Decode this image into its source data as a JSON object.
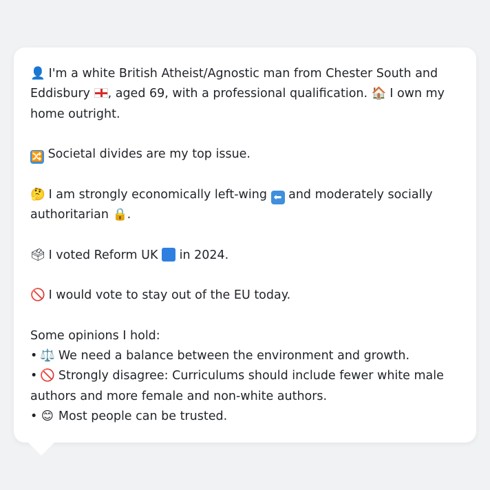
{
  "profile": {
    "line1_emoji": "👤",
    "line1_text_a": "I'm a white British Atheist/Agnostic man from Chester South and Eddisbury",
    "line1_text_b": ", aged 69, with a professional qualification.",
    "home_emoji": "🏠",
    "line1_text_c": "I own my home outright.",
    "issue_emoji": "🔀",
    "issue_text": "Societal divides are my top issue.",
    "think_emoji": "🤔",
    "econ_text_a": "I am strongly economically left-wing",
    "left_arrow_emoji": "⬅",
    "econ_text_b": "and moderately socially authoritarian",
    "lock_emoji": "🔒",
    "econ_text_c": ".",
    "ballot_emoji": "🗳",
    "vote_text_a": "I voted Reform UK",
    "vote_text_b": "in 2024.",
    "no_emoji": "🚫",
    "eu_text": "I would vote to stay out of the EU today.",
    "opinions_heading": "Some opinions I hold:",
    "opinions": [
      {
        "emoji": "⚖️",
        "text": "We need a balance between the environment and growth."
      },
      {
        "emoji": "🚫",
        "text": "Strongly disagree: Curriculums should include fewer white male authors and more female and non-white authors."
      },
      {
        "emoji": "😊",
        "text": "Most people can be trusted."
      }
    ]
  },
  "colors": {
    "background": "#f1f2f4",
    "bubble": "#ffffff",
    "text": "#1f2328",
    "reform_blue": "#2f7fe0"
  }
}
